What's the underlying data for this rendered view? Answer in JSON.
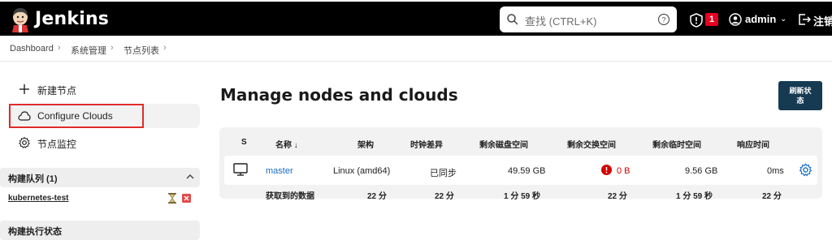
{
  "header": {
    "brand": "Jenkins",
    "search_placeholder": "查找 (CTRL+K)",
    "notification_count": "1",
    "user": "admin",
    "logout": "注销"
  },
  "breadcrumb": [
    "Dashboard",
    "系统管理",
    "节点列表"
  ],
  "sidebar": {
    "items": [
      {
        "label": "新建节点",
        "icon": "plus-icon"
      },
      {
        "label": "Configure Clouds",
        "icon": "cloud-icon"
      },
      {
        "label": "节点监控",
        "icon": "gear-icon"
      }
    ],
    "queue_title": "构建队列 (1)",
    "queue_items": [
      {
        "name": "kubernetes-test"
      }
    ],
    "executor_title": "构建执行状态"
  },
  "main": {
    "title": "Manage nodes and clouds",
    "refresh_label_line1": "刷新状",
    "refresh_label_line2": "态",
    "columns": [
      "S",
      "名称 ↓",
      "架构",
      "时钟差异",
      "剩余磁盘空间",
      "剩余交换空间",
      "剩余临时空间",
      "响应时间"
    ],
    "rows": [
      {
        "name": "master",
        "arch": "Linux (amd64)",
        "clock": "已同步",
        "disk": "49.59 GB",
        "swap": "0 B",
        "temp": "9.56 GB",
        "response": "0ms"
      }
    ],
    "footer": {
      "label": "获取到的数据",
      "values": [
        "22 分",
        "22 分",
        "1 分 59 秒",
        "22 分",
        "1 分 59 秒",
        "22 分"
      ]
    }
  },
  "colors": {
    "header_bg": "#000000",
    "link": "#1a6dc2",
    "refresh_bg": "#163a52",
    "alert": "#e6001f"
  }
}
